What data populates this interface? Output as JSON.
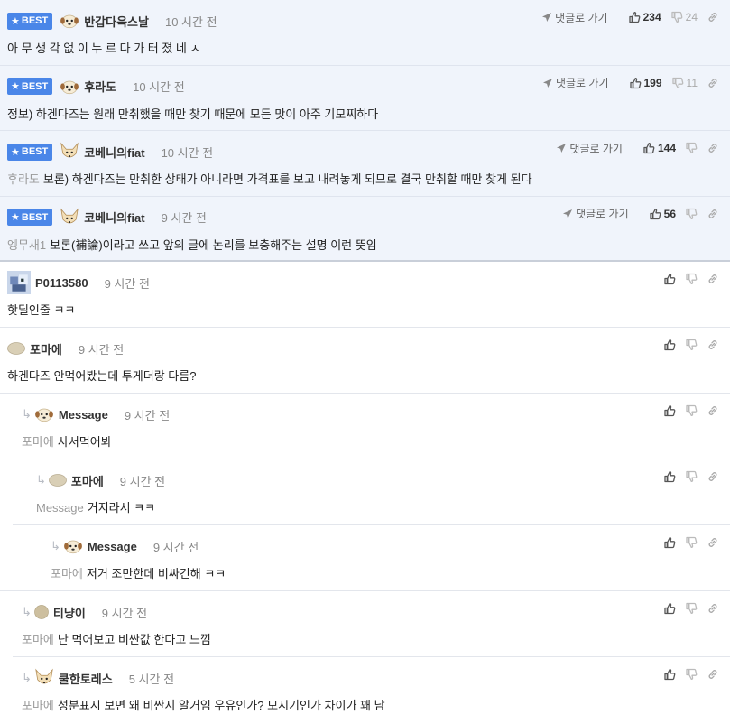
{
  "best_label": "BEST",
  "goto_label": "댓글로 가기",
  "comments": [
    {
      "nick": "반갑다육스날",
      "time": "10 시간 전",
      "ref": "",
      "text": "아 무 생 각 없 이 누 르 다 가 터 졌 네 ㅅ",
      "up": "234",
      "down": "24"
    },
    {
      "nick": "후라도",
      "time": "10 시간 전",
      "ref": "",
      "text": "정보) 하겐다즈는 원래 만취했을 때만 찾기 때문에 모든 맛이 아주 기모찌하다",
      "up": "199",
      "down": "11"
    },
    {
      "nick": "코베니의fiat",
      "time": "10 시간 전",
      "ref": "후라도",
      "text": "보론) 하겐다즈는 만취한 상태가 아니라면 가격표를 보고 내려놓게 되므로 결국 만취할 때만 찾게 된다",
      "up": "144",
      "down": ""
    },
    {
      "nick": "코베니의fiat",
      "time": "9 시간 전",
      "ref": "엥무새1",
      "text": "보론(補論)이라고 쓰고 앞의 글에 논리를 보충해주는 설명 이런 뜻임",
      "up": "56",
      "down": ""
    },
    {
      "nick": "P0113580",
      "time": "9 시간 전",
      "ref": "",
      "text": "핫딜인줄 ㅋㅋ"
    },
    {
      "nick": "포마에",
      "time": "9 시간 전",
      "ref": "",
      "text": "하겐다즈 안먹어봤는데 투게더랑 다름?"
    },
    {
      "nick": "Message",
      "time": "9 시간 전",
      "ref": "포마에",
      "text": "사서먹어봐"
    },
    {
      "nick": "포마에",
      "time": "9 시간 전",
      "ref": "Message",
      "text": "거지라서 ㅋㅋ"
    },
    {
      "nick": "Message",
      "time": "9 시간 전",
      "ref": "포마에",
      "text": "저거 조만한데 비싸긴해 ㅋㅋ"
    },
    {
      "nick": "티냥이",
      "time": "9 시간 전",
      "ref": "포마에",
      "text": "난 먹어보고 비싼값 한다고 느낌"
    },
    {
      "nick": "쿨한토레스",
      "time": "5 시간 전",
      "ref": "포마에",
      "text": "성분표시 보면 왜 비싼지 알거임 우유인가? 모시기인가 차이가 꽤 남"
    }
  ]
}
